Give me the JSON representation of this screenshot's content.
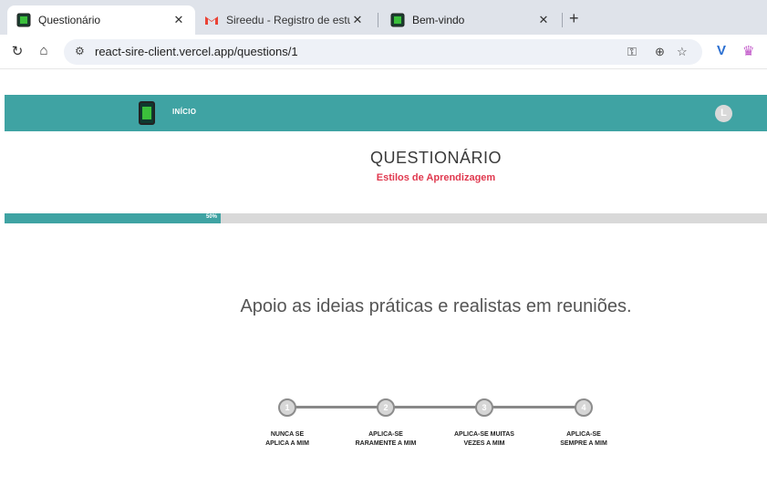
{
  "tabs": [
    {
      "title": "Questionário",
      "active": true
    },
    {
      "title": "Sireedu - Registro de estudante",
      "active": false
    },
    {
      "title": "Bem-vindo",
      "active": false
    }
  ],
  "toolbar": {
    "url": "react-sire-client.vercel.app/questions/1",
    "icons": [
      "reload-icon",
      "home-icon",
      "site-settings-icon",
      "password-key-icon",
      "zoom-icon",
      "bookmark-star-icon",
      "extension-v-icon",
      "extension-crown-icon"
    ]
  },
  "app": {
    "nav_inicio": "INÍCIO",
    "avatar_letter": "L",
    "title": "QUESTIONÁRIO",
    "subtitle": "Estilos de Aprendizagem",
    "progress_percent": 50,
    "progress_label": "50%",
    "question": "Apoio as ideias práticas e realistas em reuniões.",
    "options": [
      {
        "number": "1",
        "label": "NUNCA SE\nAPLICA A MIM"
      },
      {
        "number": "2",
        "label": "APLICA-SE\nRARAMENTE A MIM"
      },
      {
        "number": "3",
        "label": "APLICA-SE MUITAS\nVEZES A MIM"
      },
      {
        "number": "4",
        "label": "APLICA-SE\nSEMPRE A MIM"
      }
    ]
  },
  "colors": {
    "brand_teal": "#3fa3a3",
    "subtitle_red": "#e0394f",
    "track_grey": "#d9d9d9"
  }
}
